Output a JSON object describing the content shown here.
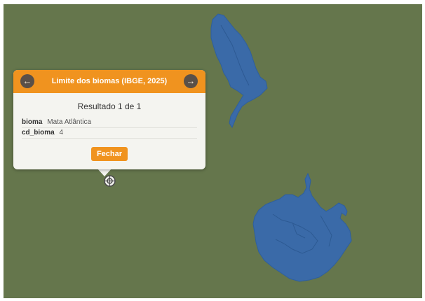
{
  "colors": {
    "map_background": "#65764c",
    "biome_fill": "#3a6aa8",
    "biome_stroke": "#2e5f9e",
    "popup_header": "#f0931f",
    "popup_body": "#f4f4f0",
    "nav_button": "#5a5048"
  },
  "icons": {
    "prev": "arrow-left-icon",
    "next": "arrow-right-icon",
    "marker": "location-marker-icon"
  },
  "popup": {
    "title": "Limite dos biomas (IBGE, 2025)",
    "result_count": "Resultado 1 de 1",
    "attributes": [
      {
        "key": "bioma",
        "value": "Mata Atlântica"
      },
      {
        "key": "cd_bioma",
        "value": "4"
      }
    ],
    "close_label": "Fechar"
  }
}
